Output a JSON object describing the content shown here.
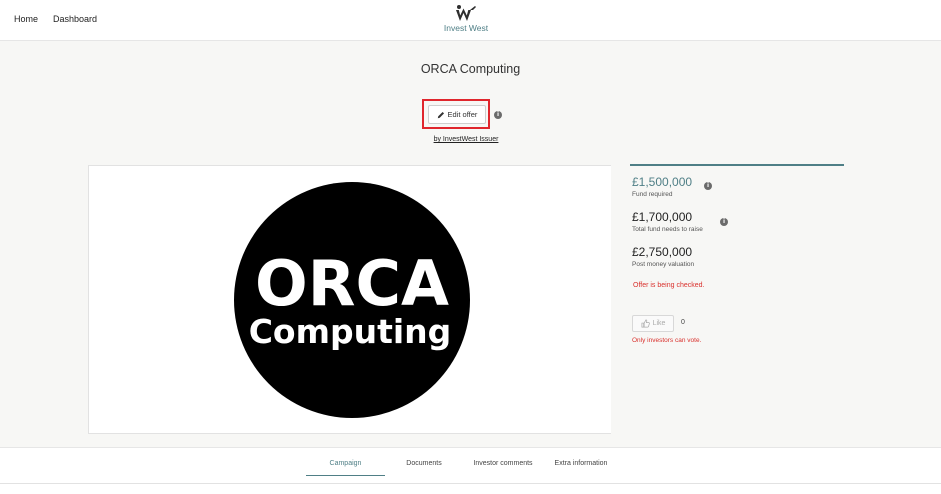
{
  "nav": {
    "home_label": "Home",
    "dashboard_label": "Dashboard",
    "brand_name": "Invest West",
    "brand_icon": "invest-west-logo"
  },
  "offer": {
    "title": "ORCA Computing",
    "edit_label": "Edit offer",
    "issuer_link": "by InvestWest Issuer",
    "logo_text_line1": "ORCA",
    "logo_text_line2": "Computing"
  },
  "stats": [
    {
      "value": "£1,500,000",
      "label": "Fund required",
      "has_info": true
    },
    {
      "value": "£1,700,000",
      "label": "Total fund needs to raise",
      "has_info": true
    },
    {
      "value": "£2,750,000",
      "label": "Post money valuation",
      "has_info": false
    }
  ],
  "status": {
    "checking": "Offer is being checked.",
    "like_label": "Like",
    "like_count": "0",
    "vote_note": "Only investors can vote."
  },
  "tabs": [
    {
      "label": "Campaign",
      "active": true
    },
    {
      "label": "Documents",
      "active": false
    },
    {
      "label": "Investor comments",
      "active": false
    },
    {
      "label": "Extra information",
      "active": false
    }
  ],
  "colors": {
    "accent": "#4f7f86",
    "alert": "#d9302c",
    "highlight": "#e0262d"
  }
}
